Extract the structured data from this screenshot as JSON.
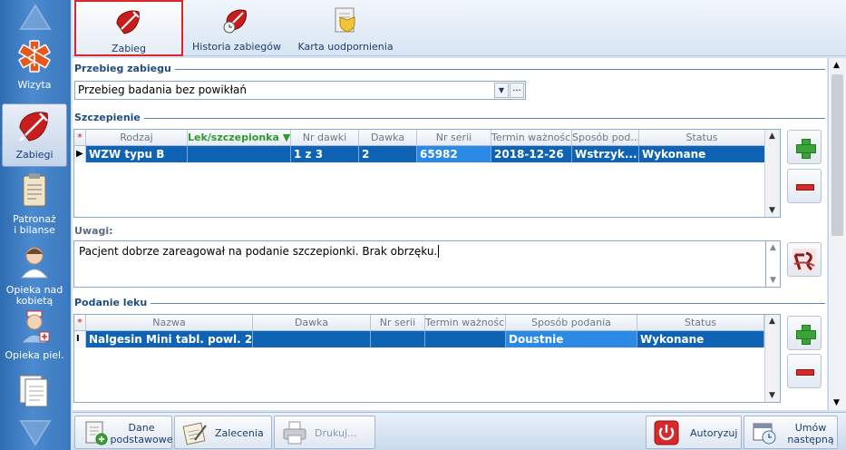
{
  "sidebar": {
    "items": [
      {
        "label": "Wizyta",
        "icon": "medical-star-icon"
      },
      {
        "label": "Zabiegi",
        "icon": "syringe-icon"
      },
      {
        "label": "Patronaż\ni bilanse",
        "icon": "clipboard-icon"
      },
      {
        "label": "Opieka nad\nkobietą",
        "icon": "woman-doctor-icon"
      },
      {
        "label": "Opieka piel.",
        "icon": "nurse-icon"
      },
      {
        "label": "",
        "icon": "documents-icon"
      }
    ]
  },
  "toolbar": {
    "zabieg": "Zabieg",
    "historia": "Historia zabiegów",
    "karta": "Karta uodpornienia"
  },
  "przebieg": {
    "title": "Przebieg zabiegu",
    "value": "Przebieg badania bez powikłań",
    "dots": "..."
  },
  "szczepienie": {
    "title": "Szczepienie",
    "columns": [
      "*",
      "Rodzaj",
      "Lek/szczepionka ▼",
      "Nr dawki",
      "Dawka",
      "Nr serii",
      "Termin ważności",
      "Sposób pod...",
      "Status"
    ],
    "row": [
      "▶",
      "WZW typu B",
      "",
      "1 z 3",
      "2",
      "65982",
      "2018-12-26",
      "Wstrzyk...",
      "Wykonane"
    ]
  },
  "uwagi": {
    "title": "Uwagi:",
    "text": "Pacjent dobrze zareagował na podanie szczepionki. Brak obrzęku."
  },
  "podanie": {
    "title": "Podanie leku",
    "columns": [
      "*",
      "Nazwa",
      "Dawka",
      "Nr serii",
      "Termin ważności",
      "Sposób podania",
      "Status"
    ],
    "row": [
      "I",
      "Nalgesin Mini tabl. powl. 2...",
      "",
      "",
      "",
      "Doustnie",
      "Wykonane"
    ]
  },
  "bottom": {
    "dane": "Dane\npodstawowe",
    "zalecenia": "Zalecenia",
    "drukuj": "Drukuj...",
    "autoryzuj": "Autoryzuj",
    "umow": "Umów\nnastępną"
  },
  "colors": {
    "selection": "#0f63b5",
    "accent_border": "#e0242b",
    "green_header": "#2f9a2f"
  }
}
